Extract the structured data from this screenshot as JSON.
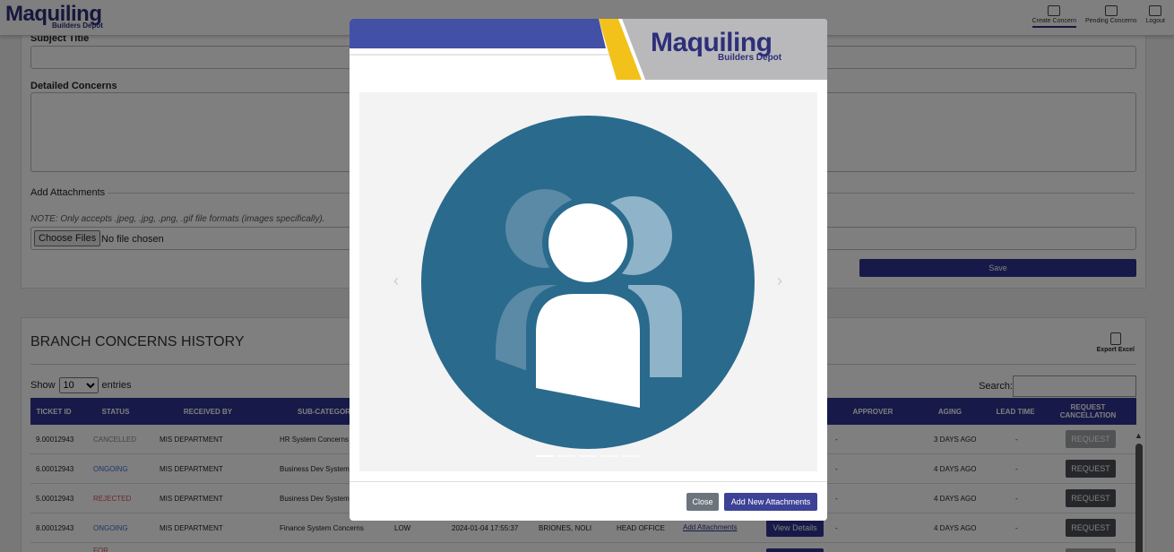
{
  "header": {
    "logo_main": "Maquiling",
    "logo_sub": "Builders Depot",
    "nav": [
      {
        "label": "Create Concern",
        "icon": "create-concern-icon"
      },
      {
        "label": "Pending Concerns",
        "icon": "pending-concerns-icon"
      },
      {
        "label": "Logout",
        "icon": "logout-icon"
      }
    ]
  },
  "form": {
    "subject_label": "Subject Title",
    "detailed_label": "Detailed Concerns",
    "attachments_label": "Add Attachments",
    "note": "NOTE: Only accepts .jpeg, .jpg, .png, .gif file formats (images specifically).",
    "choose_files": "Choose Files",
    "no_file": "No file chosen",
    "save": "Save"
  },
  "history": {
    "title": "BRANCH CONCERNS HISTORY",
    "export_label": "Export Excel",
    "show_label": "Show",
    "entries_label": "entries",
    "page_size": "10",
    "search_label": "Search:",
    "columns": [
      "TICKET ID",
      "STATUS",
      "RECEIVED BY",
      "SUB-CATEGORY",
      "APPROVER",
      "AGING",
      "LEAD TIME",
      "REQUEST CANCELLATION"
    ],
    "rows": [
      {
        "ticket": "9.00012943",
        "status": "CANCELLED",
        "received_by": "MIS DEPARTMENT",
        "subcat": "HR System Concerns",
        "extra": "-",
        "aging": "3 DAYS AGO",
        "lead": "-",
        "request": "REQUEST"
      },
      {
        "ticket": "6.00012943",
        "status": "ONGOING",
        "received_by": "MIS DEPARTMENT",
        "subcat": "Business Dev System",
        "extra": "-",
        "aging": "4 DAYS AGO",
        "lead": "-",
        "request": "REQUEST"
      },
      {
        "ticket": "5.00012943",
        "status": "REJECTED",
        "received_by": "MIS DEPARTMENT",
        "subcat": "Business Dev System",
        "extra": "-",
        "aging": "4 DAYS AGO",
        "lead": "-",
        "request": "REQUEST"
      },
      {
        "ticket": "8.00012943",
        "status": "ONGOING",
        "received_by": "MIS DEPARTMENT",
        "subcat": "Finance System Concerns",
        "priority": "LOW",
        "date": "2024-01-04 17:55:37",
        "approver_name": "BRIONES, NOLI",
        "office": "HEAD OFFICE",
        "attach": "Add  Attachments",
        "view": "View Details",
        "extra": "-",
        "aging": "4 DAYS AGO",
        "lead": "-",
        "request": "REQUEST"
      }
    ],
    "partial_status": "FOR"
  },
  "modal": {
    "logo_main": "Maquiling",
    "logo_sub": "Builders Depot",
    "image_alt": "users-placeholder",
    "close": "Close",
    "add_new": "Add New Attachments",
    "prev": "‹",
    "next": "›"
  },
  "colors": {
    "brand_navy": "#2e3490",
    "banner_blue": "#4250a6",
    "banner_yellow": "#f2c21b",
    "banner_gray": "#b9b9bb",
    "avatar_circle": "#2a6a8c"
  }
}
